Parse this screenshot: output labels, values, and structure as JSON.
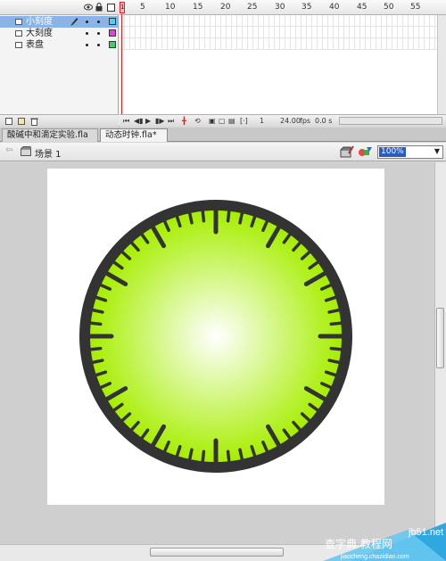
{
  "timeline": {
    "frame_numbers": [
      "1",
      "5",
      "10",
      "15",
      "20",
      "25",
      "30",
      "35",
      "40",
      "45",
      "50",
      "55"
    ],
    "layers": [
      {
        "name": "小刻度",
        "selected": true,
        "color": "#55ccee"
      },
      {
        "name": "大刻度",
        "selected": false,
        "color": "#dd44dd"
      },
      {
        "name": "表盘",
        "selected": false,
        "color": "#44cc66"
      }
    ],
    "current_frame": "1",
    "frame_rate": "24.00",
    "fps_unit": "fps",
    "elapsed": "0.0 s"
  },
  "tabs": [
    {
      "label": "酸碱中和滴定实验.fla"
    },
    {
      "label": "动态时钟.fla*"
    }
  ],
  "editbar": {
    "scene_label": "场景 1",
    "zoom": "100%"
  },
  "clock": {
    "face_color_center": "#ffffff",
    "face_color_edge": "#a6ee00",
    "rim_color": "#333333"
  },
  "watermark": {
    "line1": "jb51.net",
    "line2": "查字典 教程网",
    "line3": "jiaocheng.chazidian.com"
  }
}
